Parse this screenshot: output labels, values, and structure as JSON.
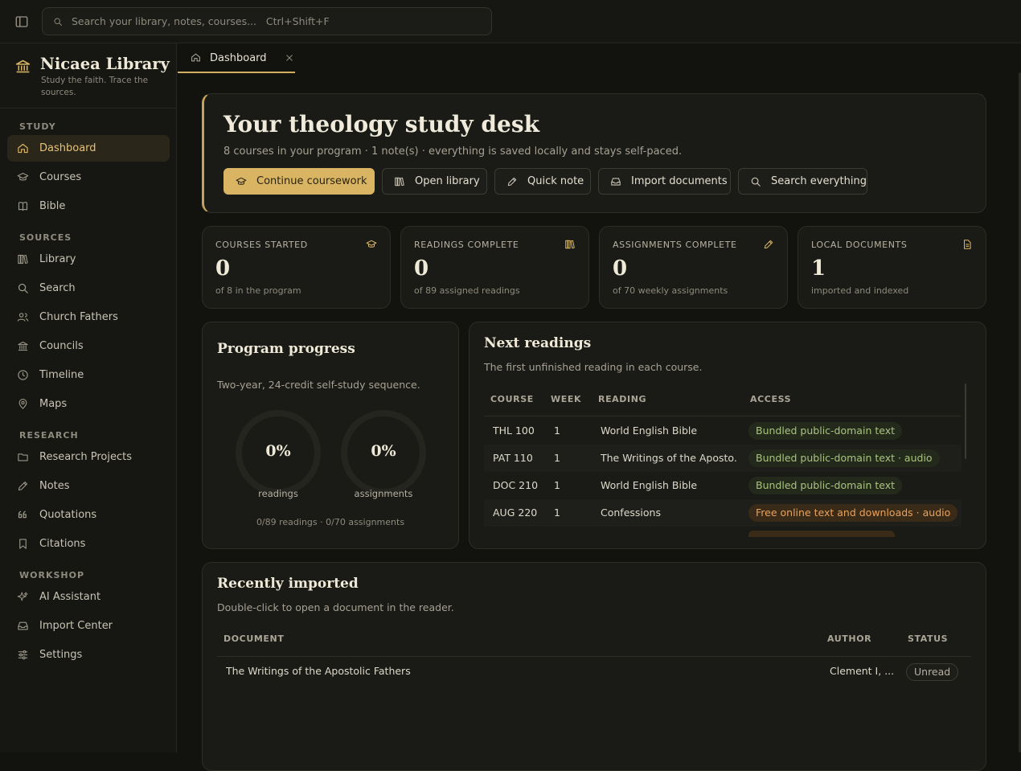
{
  "topbar": {
    "search_placeholder": "Search your library, notes, courses...   Ctrl+Shift+F"
  },
  "brand": {
    "title": "Nicaea Library",
    "subtitle": "Study the faith. Trace the sources."
  },
  "sidebar": {
    "sections": {
      "study": "STUDY",
      "sources": "SOURCES",
      "research": "RESEARCH",
      "workshop": "WORKSHOP"
    },
    "items": {
      "dashboard": "Dashboard",
      "courses": "Courses",
      "bible": "Bible",
      "library": "Library",
      "search": "Search",
      "church_fathers": "Church Fathers",
      "councils": "Councils",
      "timeline": "Timeline",
      "maps": "Maps",
      "research_projects": "Research Projects",
      "notes": "Notes",
      "quotations": "Quotations",
      "citations": "Citations",
      "ai_assistant": "AI Assistant",
      "import_center": "Import Center",
      "settings": "Settings"
    }
  },
  "tabs": [
    {
      "label": "Dashboard"
    }
  ],
  "hero": {
    "title": "Your theology study desk",
    "subtitle": "8 courses in your program · 1 note(s) · everything is saved locally and stays self-paced.",
    "buttons": {
      "continue": "Continue coursework",
      "library": "Open library",
      "note": "Quick note",
      "import": "Import documents",
      "search": "Search everything"
    }
  },
  "stats": [
    {
      "label": "COURSES STARTED",
      "value": "0",
      "sub": "of 8 in the program",
      "icon": "graduation-cap-icon"
    },
    {
      "label": "READINGS COMPLETE",
      "value": "0",
      "sub": "of 89 assigned readings",
      "icon": "books-icon"
    },
    {
      "label": "ASSIGNMENTS COMPLETE",
      "value": "0",
      "sub": "of 70 weekly assignments",
      "icon": "pencil-icon"
    },
    {
      "label": "LOCAL DOCUMENTS",
      "value": "1",
      "sub": "imported and indexed",
      "icon": "document-icon"
    }
  ],
  "progress": {
    "title": "Program progress",
    "subtitle": "Two-year, 24-credit self-study sequence.",
    "readings_pct": "0%",
    "readings_label": "readings",
    "readings_fraction": 0,
    "assignments_pct": "0%",
    "assignments_label": "assignments",
    "assignments_fraction": 0,
    "footer": "0/89 readings · 0/70 assignments"
  },
  "next_readings": {
    "title": "Next readings",
    "subtitle": "The first unfinished reading in each course.",
    "headers": {
      "course": "COURSE",
      "week": "WEEK",
      "reading": "READING",
      "access": "ACCESS"
    },
    "rows": [
      {
        "course": "THL 100",
        "week": "1",
        "reading": "World English Bible",
        "access": "Bundled public-domain text"
      },
      {
        "course": "PAT 110",
        "week": "1",
        "reading": "The Writings of the Aposto...",
        "access": "Bundled public-domain text · audio"
      },
      {
        "course": "DOC 210",
        "week": "1",
        "reading": "World English Bible",
        "access": "Bundled public-domain text"
      },
      {
        "course": "AUG 220",
        "week": "1",
        "reading": "Confessions",
        "access": "Free online text and downloads · audio"
      }
    ]
  },
  "recent": {
    "title": "Recently imported",
    "subtitle": "Double-click to open a document in the reader.",
    "headers": {
      "document": "DOCUMENT",
      "author": "AUTHOR",
      "status": "STATUS"
    },
    "rows": [
      {
        "document": "The Writings of the Apostolic Fathers",
        "author": "Clement I, ...",
        "status": "Unread"
      }
    ]
  },
  "colors": {
    "accent": "#d9b563",
    "background": "#12130f",
    "card": "#1a1b16",
    "green_pill_text": "#a9c37e",
    "orange_pill_text": "#e9a25c"
  }
}
